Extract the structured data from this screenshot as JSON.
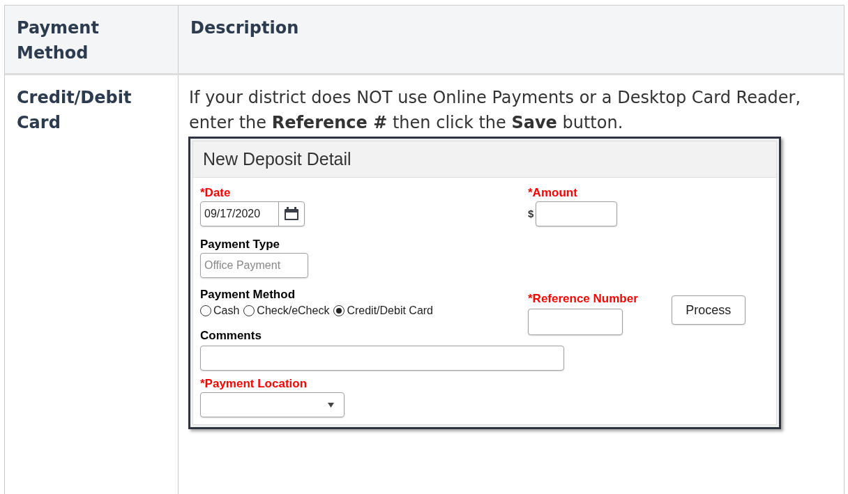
{
  "table": {
    "columns": [
      "Payment Method",
      "Description"
    ],
    "rows": [
      {
        "method": "Credit/Debit Card",
        "description": "If your district does NOT use Online Payments or a Desktop Card Reader, enter the **Reference #** then click the **Save** button.",
        "screenshot": {
          "title": "New Deposit Detail",
          "date": {
            "label": "*Date",
            "required": true,
            "value": "09/17/2020"
          },
          "amount": {
            "label": "*Amount",
            "required": true,
            "currency": "$"
          },
          "payment_type": {
            "label": "Payment Type",
            "required": false,
            "placeholder": "Office Payment"
          },
          "payment_method": {
            "label": "Payment Method",
            "required": false,
            "options": [
              {
                "label": "Cash",
                "selected": false
              },
              {
                "label": "Check/eCheck",
                "selected": false
              },
              {
                "label": "Credit/Debit Card",
                "selected": true
              }
            ]
          },
          "reference_number": {
            "label": "*Reference Number",
            "required": true
          },
          "process_button": "Process",
          "comments": {
            "label": "Comments",
            "required": false
          },
          "payment_location": {
            "label": "*Payment Location",
            "required": true
          }
        }
      }
    ]
  }
}
